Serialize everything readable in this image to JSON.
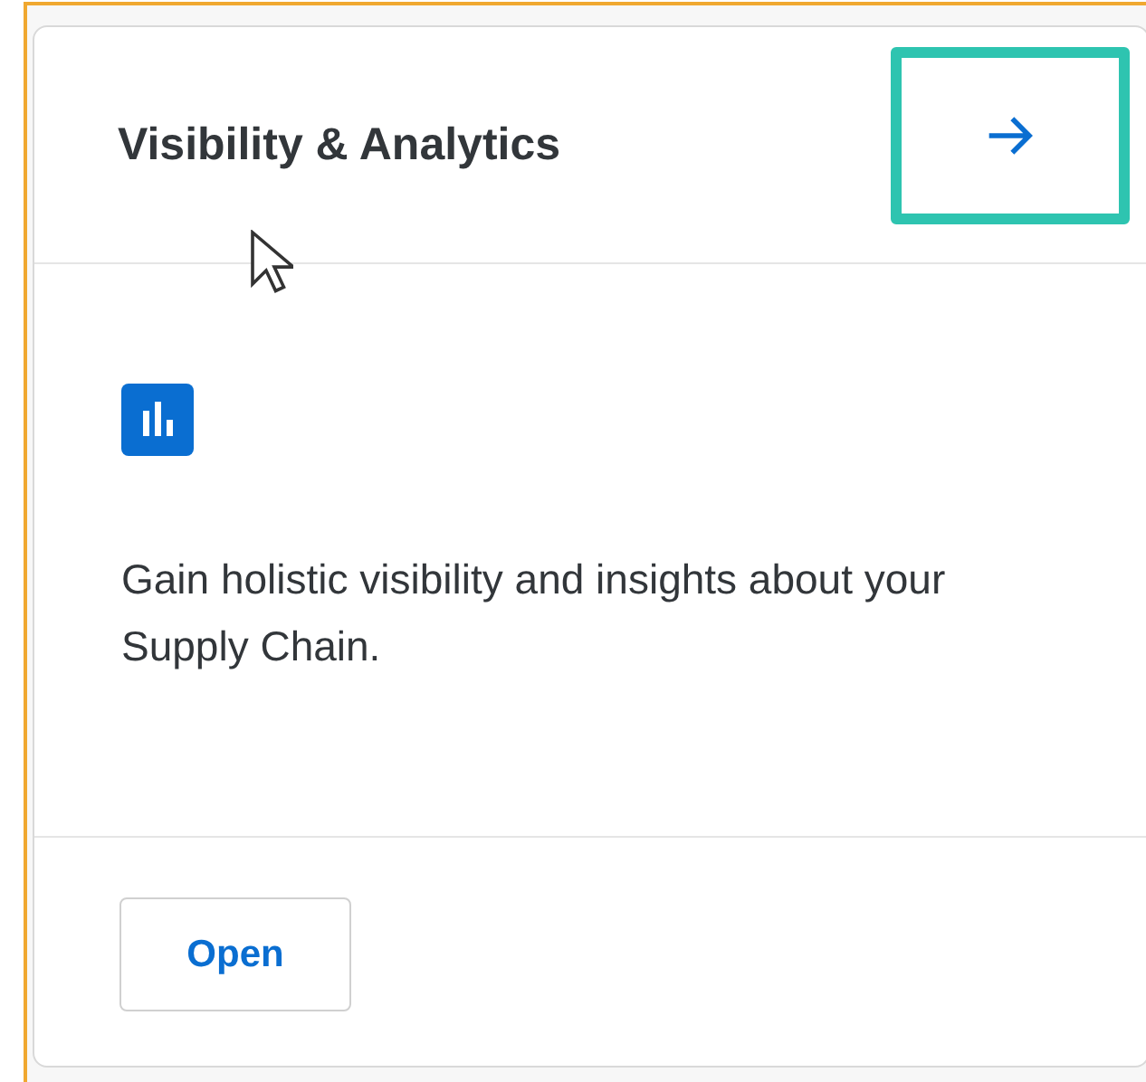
{
  "card": {
    "title": "Visibility & Analytics",
    "header_button": {
      "highlighted": true
    },
    "description": "Gain holistic visibility and insights about your Supply Chain.",
    "footer_button": {
      "label": "Open"
    }
  }
}
